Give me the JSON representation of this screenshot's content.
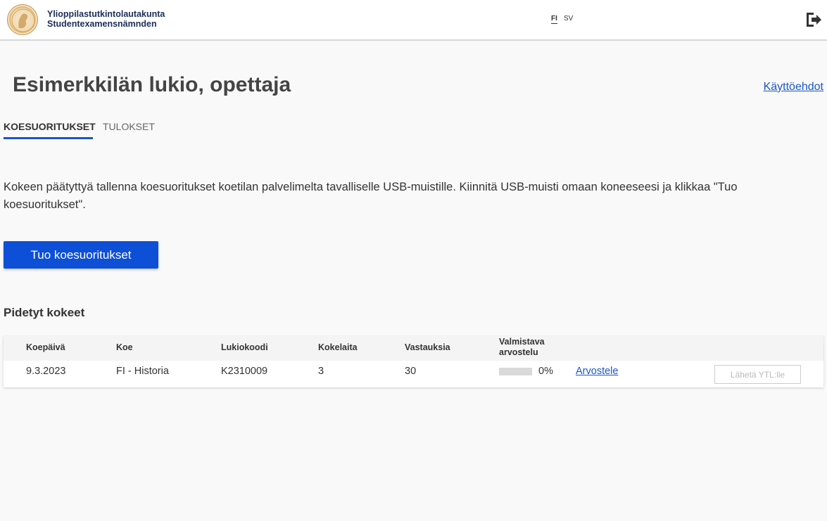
{
  "header": {
    "org_line1": "Ylioppilastutkintolautakunta",
    "org_line2": "Studentexamensnämnden",
    "lang_fi": "FI",
    "lang_sv": "SV",
    "logo_icon": "ytl-logo-icon",
    "logout_icon": "logout-icon"
  },
  "page": {
    "title": "Esimerkkilän lukio, opettaja",
    "terms_link": "Käyttöehdot"
  },
  "tabs": [
    {
      "label": "KOESUORITUKSET",
      "active": true
    },
    {
      "label": "TULOKSET",
      "active": false
    }
  ],
  "instructions": "Kokeen päätyttyä tallenna koesuoritukset koetilan palvelimelta tavalliselle USB-muistille. Kiinnitä USB-muisti omaan koneeseesi ja klikkaa \"Tuo koesuoritukset\".",
  "import_button": "Tuo koesuoritukset",
  "section_title": "Pidetyt kokeet",
  "table": {
    "columns": {
      "date": "Koepäivä",
      "exam": "Koe",
      "school_code": "Lukiokoodi",
      "candidates": "Kokelaita",
      "answers": "Vastauksia",
      "preliminary_1": "Valmistava",
      "preliminary_2": "arvostelu"
    },
    "rows": [
      {
        "date": "9.3.2023",
        "exam": "FI - Historia",
        "school_code": "K2310009",
        "candidates": "3",
        "answers": "30",
        "progress_percent": 0,
        "progress_label": "0%",
        "grade_link": "Arvostele",
        "send_button": "Lähetä YTL:lle"
      }
    ]
  },
  "colors": {
    "primary": "#0d4fd6",
    "link": "#1a56c4",
    "org_text": "#1c2e57"
  }
}
